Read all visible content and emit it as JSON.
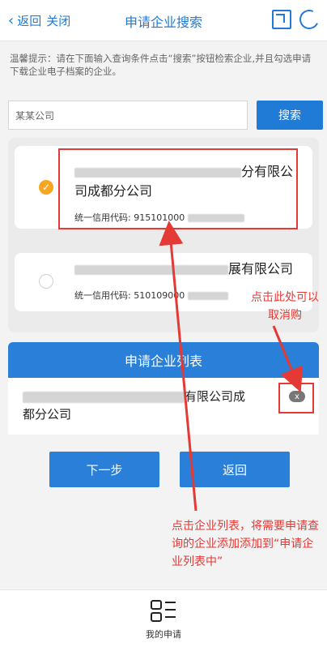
{
  "topbar": {
    "back_label": "返回",
    "close_label": "关闭",
    "title": "申请企业搜索"
  },
  "tip": {
    "text": "温馨提示：请在下面输入查询条件点击“搜索”按钮检索企业,并且勾选申请下载企业电子档案的企业。"
  },
  "search": {
    "value": "某某公司",
    "button_label": "搜索"
  },
  "results": [
    {
      "name_line1_suffix": "分有限公",
      "name_line2": "司成都分公司",
      "code_label": "统一信用代码:",
      "code_value": "915101000",
      "checked": true
    },
    {
      "name_line1_suffix": "展有限公司",
      "code_label": "统一信用代码:",
      "code_value": "510109000",
      "checked": false
    }
  ],
  "apply_list": {
    "header": "申请企业列表",
    "item_line1_suffix": "有限公司成",
    "item_line2": "都分公司",
    "remove_icon": "x"
  },
  "buttons": {
    "next": "下一步",
    "back": "返回"
  },
  "annotations": {
    "cancel_hint": "点击此处可以取消购",
    "add_hint": "点击企业列表，将需要申请查询的企业添加添加到“申请企业列表中”"
  },
  "bottom_nav": {
    "my_apply_label": "我的申请"
  },
  "colors": {
    "primary": "#2a7fd8",
    "accent_check": "#f5a623",
    "annotation": "#e53935"
  }
}
